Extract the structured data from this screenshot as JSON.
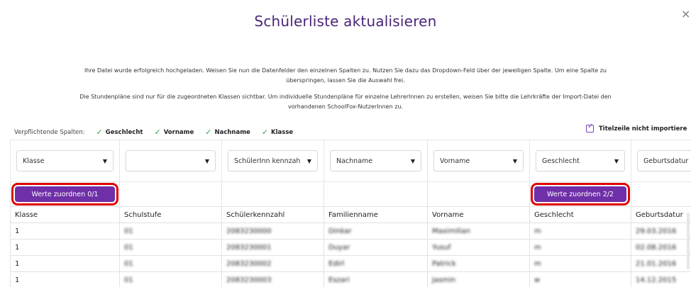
{
  "dialog": {
    "title": "Schülerliste aktualisieren",
    "close_label": "×",
    "info_lines": [
      "Ihre Datei wurde erfolgreich hochgeladen. Weisen Sie nun die Datenfelder den einzelnen Spalten zu. Nutzen Sie dazu das Dropdown-Feld über der jeweiligen Spalte. Um eine Spalte zu",
      "überspringen, lassen Sie die Auswahl frei."
    ],
    "schedule_lines": [
      "Die Stundenpläne sind nur für die zugeordneten Klassen sichtbar. Um individuelle Stundenpläne für einzelne LehrerInnen zu erstellen, weisen Sie bitte die Lehrkräfte der Import-Datei den",
      "vorhandenen SchoolFox-NutzerInnen zu."
    ],
    "required_label": "Verpflichtende Spalten:",
    "required_columns": [
      "Geschlecht",
      "Vorname",
      "Nachname",
      "Klasse"
    ],
    "title_row_checkbox_label": "Titelzeile nicht importiere",
    "title_row_checked": true
  },
  "colors": {
    "accent": "#6f2fa8",
    "title": "#4a2578",
    "check": "#2aa84a",
    "highlight": "#e00000"
  },
  "columns": [
    {
      "dropdown": "Klasse",
      "header": "Klasse"
    },
    {
      "dropdown": "",
      "header": "Schulstufe"
    },
    {
      "dropdown": "SchülerInn  kennzah",
      "header": "Schülerkennzahl"
    },
    {
      "dropdown": "Nachname",
      "header": "Familienname"
    },
    {
      "dropdown": "Vorname",
      "header": "Vorname"
    },
    {
      "dropdown": "Geschlecht",
      "header": "Geschlecht"
    },
    {
      "dropdown": "Geburtsdatur",
      "header": "Geburtsdatur"
    }
  ],
  "buttons": {
    "klasse": "Werte zuordnen  0/1",
    "geschlecht": "Werte zuordnen  2/2"
  },
  "rows": [
    [
      "1",
      "01",
      "2083230000",
      "Dinkar",
      "Maximilian",
      "m",
      "29.03.2016"
    ],
    [
      "1",
      "01",
      "2083230001",
      "Duyar",
      "Yusuf",
      "m",
      "02.08.2016"
    ],
    [
      "1",
      "01",
      "2083230002",
      "Edirl",
      "Patrick",
      "m",
      "21.01.2016"
    ],
    [
      "1",
      "01",
      "2083230003",
      "Eszari",
      "Jasmin",
      "w",
      "14.12.2015"
    ]
  ]
}
